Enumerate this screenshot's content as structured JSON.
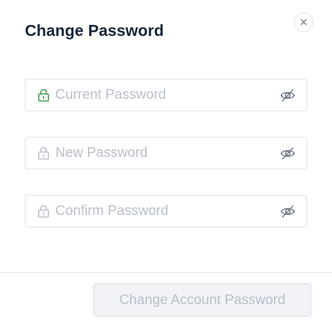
{
  "dialog": {
    "title": "Change Password",
    "close_icon": "close-icon"
  },
  "fields": [
    {
      "placeholder": "Current Password",
      "value": "",
      "icon": "lock-icon",
      "lock_color": "#3a9a4b",
      "toggle_icon": "eye-off-icon"
    },
    {
      "placeholder": "New Password",
      "value": "",
      "icon": "lock-icon",
      "lock_color": "#b9c0cc",
      "toggle_icon": "eye-off-icon"
    },
    {
      "placeholder": "Confirm Password",
      "value": "",
      "icon": "lock-icon",
      "lock_color": "#b9c0cc",
      "toggle_icon": "eye-off-icon"
    }
  ],
  "footer": {
    "submit_label": "Change Account Password",
    "submit_disabled": true
  },
  "colors": {
    "title": "#17253a",
    "placeholder": "#b9c0cc",
    "active_lock": "#3a9a4b",
    "border": "#dde1e6",
    "disabled_button_bg": "#f1f3f6"
  }
}
